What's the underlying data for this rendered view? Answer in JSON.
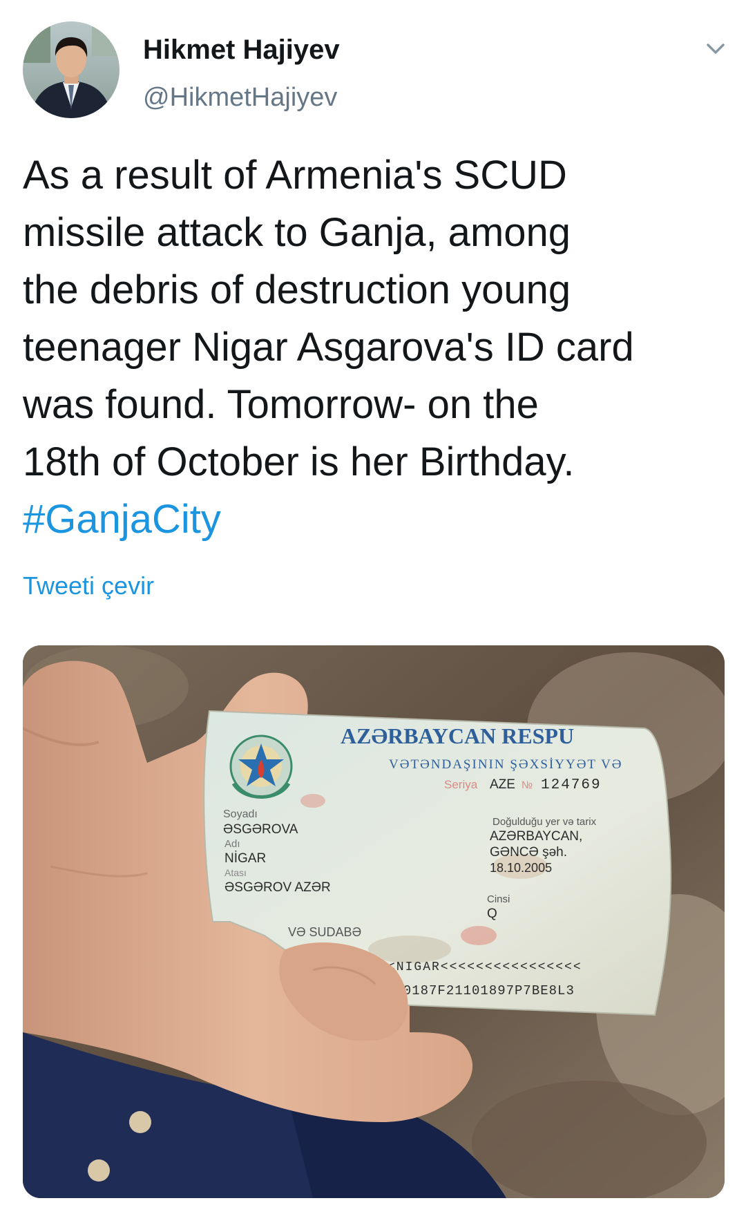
{
  "author": {
    "display_name": "Hikmet Hajiyev",
    "handle": "@HikmetHajiyev",
    "avatar_icon": "person-portrait"
  },
  "menu": {
    "icon": "chevron-down-icon"
  },
  "tweet": {
    "lines": [
      "As a result of Armenia's SCUD",
      "missile attack to Ganja, among",
      "the debris of destruction young",
      "teenager Nigar Asgarova's ID card",
      "was found. Tomorrow- on the",
      "18th of October is her Birthday."
    ],
    "hashtag": "#GanjaCity",
    "translate_label": "Tweeti çevir"
  },
  "id_card": {
    "header": "AZƏRBAYCAN RESPU",
    "subheader": "VƏTƏNDAŞININ ŞƏXSİYYƏT VƏ",
    "serial_label": "Seriya",
    "serial_value": "AZE",
    "number_label": "№",
    "number_value": "124769",
    "surname_label": "Soyadı",
    "surname_value": "ƏSGƏROVA",
    "name_label": "Adı",
    "name_value": "NİGAR",
    "father_label": "Atası",
    "father_value": "ƏSGƏROV AZƏR",
    "birth_label": "Doğulduğu yer və tarix",
    "birth_country": "AZƏRBAYCAN,",
    "birth_city": "GƏNCƏ şəh.",
    "birth_date": "18.10.2005",
    "sex_label": "Cinsi",
    "sex_value": "Q",
    "issuer_text": "VƏ SUDABƏ",
    "mrz_line1": "<NIGAR<<<<<<<<<<<<<<<<",
    "mrz_line2": "510187F21101897P7BE8L3"
  },
  "colors": {
    "text": "#14171a",
    "secondary": "#657786",
    "link": "#1b95e0"
  }
}
